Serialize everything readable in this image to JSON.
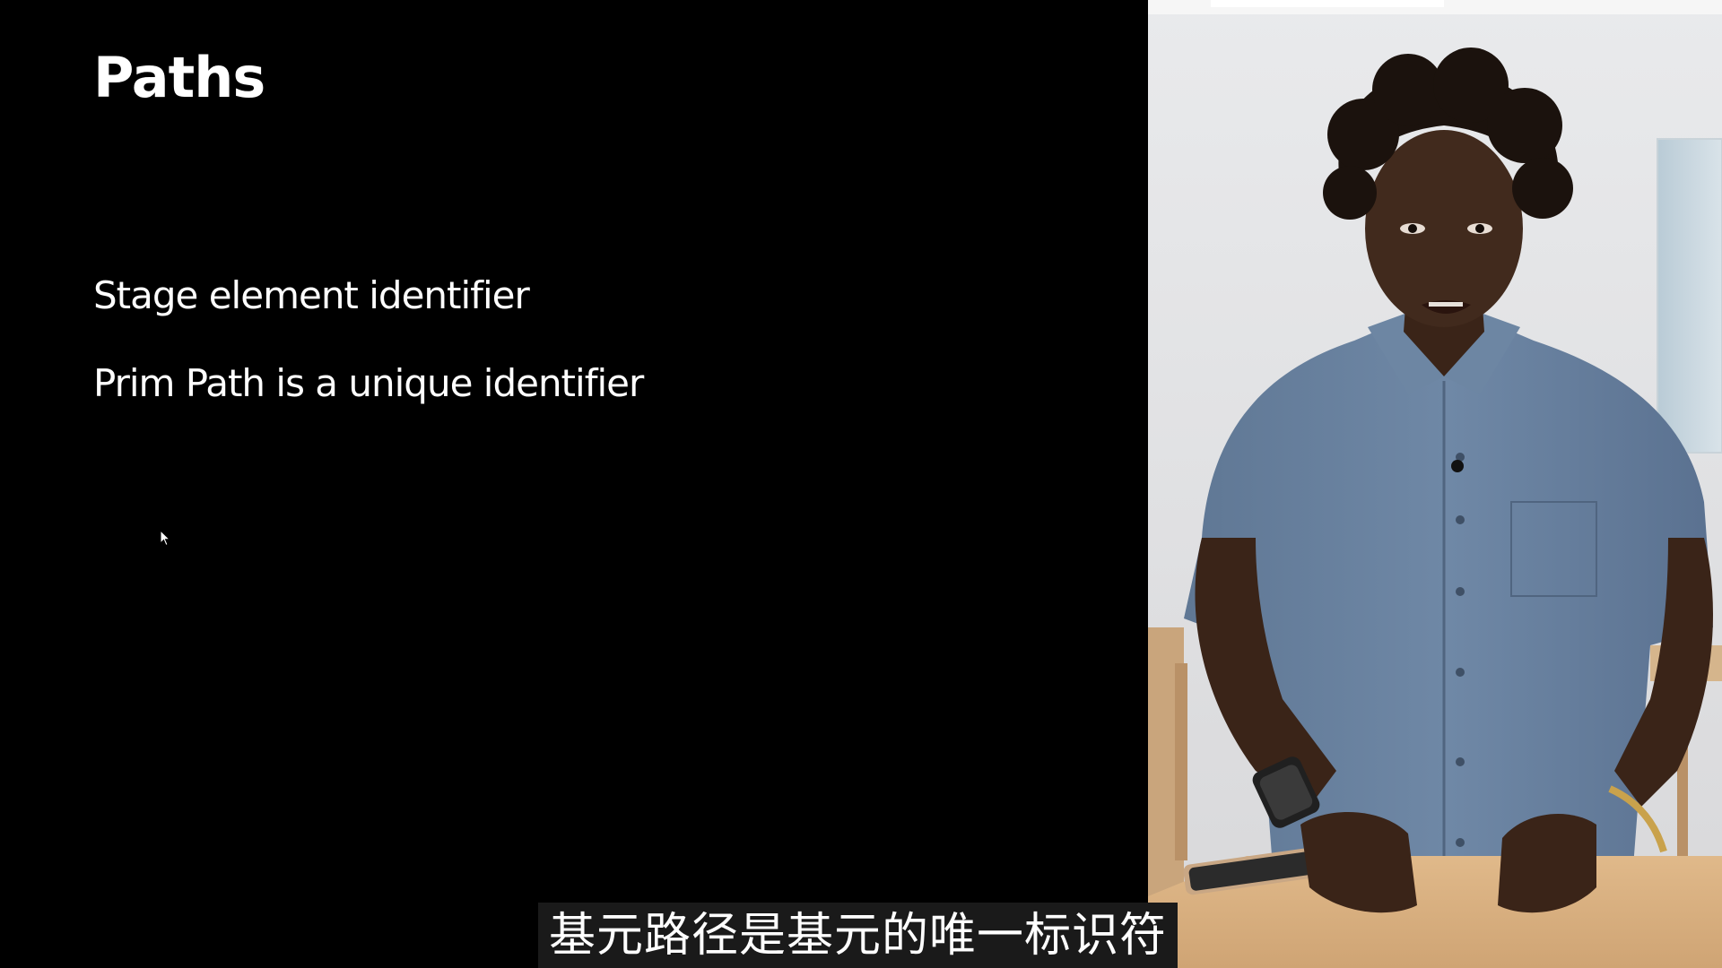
{
  "slide": {
    "title": "Paths",
    "bullets": [
      "Stage element identifier",
      "Prim Path is a unique identifier"
    ]
  },
  "subtitle": {
    "text": "基元路径是基元的唯一标识符"
  },
  "colors": {
    "background": "#000000",
    "text": "#ffffff",
    "subtitle_bar": "#1a1a1a"
  }
}
